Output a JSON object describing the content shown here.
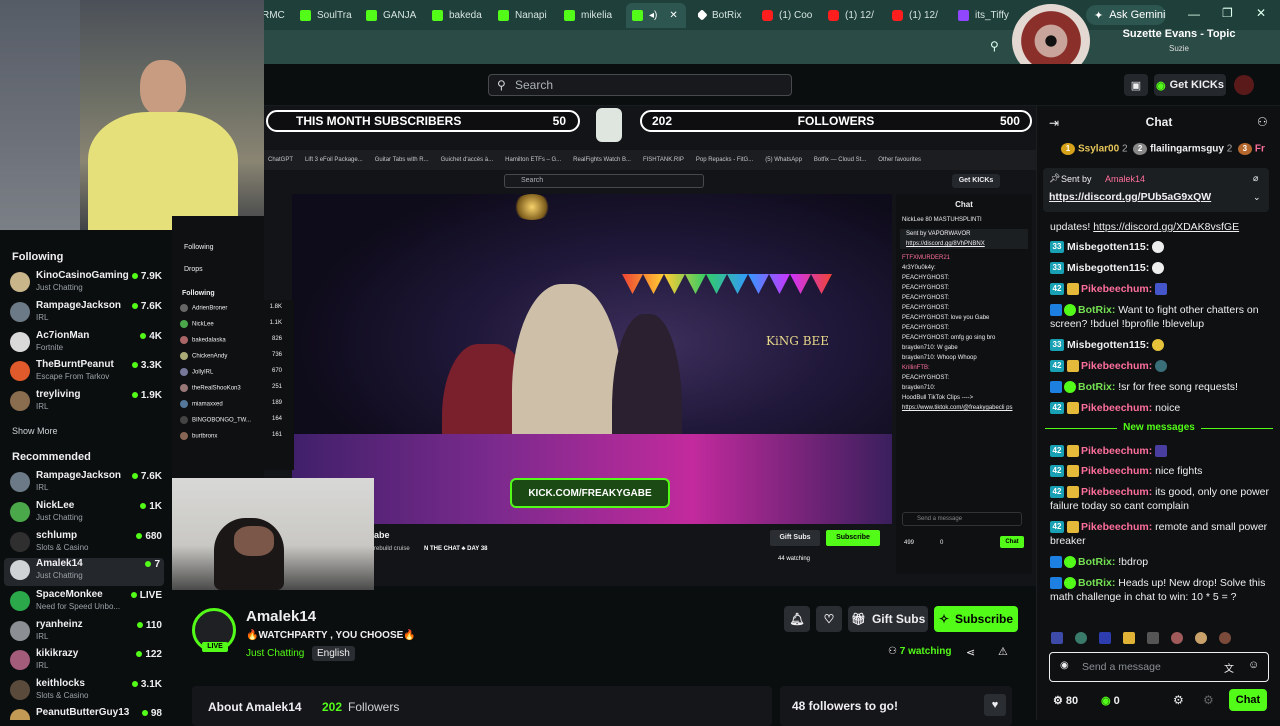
{
  "browser": {
    "tabs": [
      {
        "label": "RMC",
        "icon": "kick"
      },
      {
        "label": "SoulTra",
        "icon": "kick"
      },
      {
        "label": "GANJA",
        "icon": "kick"
      },
      {
        "label": "bakeda",
        "icon": "kick"
      },
      {
        "label": "Nanapi",
        "icon": "kick"
      },
      {
        "label": "mikelia",
        "icon": "kick"
      },
      {
        "label": "",
        "icon": "kick"
      },
      {
        "label": "BotRix",
        "icon": "botrix"
      },
      {
        "label": "(1) Coo",
        "icon": "youtube"
      },
      {
        "label": "(1) 12/",
        "icon": "youtube"
      },
      {
        "label": "(1) 12/",
        "icon": "youtube"
      },
      {
        "label": "its_Tiffy",
        "icon": "twitch"
      }
    ],
    "ask_gemini": "Ask Gemini"
  },
  "media": {
    "title": "Suzette Evans - Topic",
    "artist": "Suzie"
  },
  "header": {
    "search_placeholder": "Search",
    "get_kicks": "Get KICKs"
  },
  "overlay": {
    "subs_label": "THIS MONTH SUBSCRIBERS",
    "subs_value": "50",
    "followers_current": "202",
    "followers_label": "FOLLOWERS",
    "followers_goal": "500"
  },
  "inner": {
    "search_placeholder": "Search",
    "get_kicks": "Get KICKs",
    "bookmarks": [
      "ChatGPT",
      "Lift 3 eFoil Package...",
      "Guitar Tabs with R...",
      "Guichet d'accès à...",
      "Hamilton ETFs – G...",
      "RealFights Watch B...",
      "FISHTANK.RIP",
      "Pop Repacks - FitG...",
      "(5) WhatsApp",
      "Botfix — Cloud St...",
      "Other favourites"
    ],
    "nav": [
      "Following",
      "Drops"
    ],
    "following_header": "Following",
    "following": [
      {
        "name": "AdrienBroner",
        "cat": "",
        "viewers": "1.8K"
      },
      {
        "name": "NickLee",
        "cat": "Just Chatting",
        "viewers": "1.1K"
      },
      {
        "name": "bakedalaska",
        "cat": "The Legend of Zelda:...",
        "viewers": "826"
      },
      {
        "name": "ChickenAndy",
        "cat": "IRL",
        "viewers": "736"
      },
      {
        "name": "JollyIRL",
        "cat": "IRL",
        "viewers": "670"
      },
      {
        "name": "theRealShooKon3",
        "cat": "IRL",
        "viewers": "251"
      },
      {
        "name": "miamaxxed",
        "cat": "IRL",
        "viewers": "189"
      },
      {
        "name": "BINGOBONGO_TW...",
        "cat": "Silent Hill 2 Remake",
        "viewers": "164"
      },
      {
        "name": "burtbronx",
        "cat": "IRL",
        "viewers": "161"
      }
    ],
    "banner": "KICK.COM/FREAKYGABE",
    "stage_sign": "KiNG BEE",
    "streamer_partial": "abe",
    "stream_title_partial": "rebuild cruise",
    "ticker": "N THE CHAT ♣ DAY 38",
    "gift_subs": "Gift Subs",
    "subscribe": "Subscribe",
    "watching": "44 watching",
    "chat_title": "Chat",
    "chat_lines": [
      "NickLee 80  MASTUHSPLINTI",
      "Sent by VAPORWAVOR",
      "https://discord.gg/8VhPNBNX",
      "FTFXMURDER21",
      "4r3Y0u0k4y:",
      "PEACHYGHOST:",
      "PEACHYGHOST:",
      "PEACHYGHOST:",
      "PEACHYGHOST:",
      "PEACHYGHOST: love you Gabe",
      "PEACHYGHOST:",
      "PEACHYGHOST: omfg go sing bro",
      "brayden710: W gabe",
      "brayden710: Whoop Whoop",
      "KrillinFTB:",
      "PEACHYGHOST:",
      "brayden710:",
      "HoodBull TikTok Clips ---->",
      "https://www.tiktok.com/@freakygabecli ps"
    ],
    "send_placeholder": "Send a message",
    "points": "499",
    "kicks": "0",
    "chat_btn": "Chat"
  },
  "sidebar": {
    "following_header": "Following",
    "following": [
      {
        "name": "KinoCasinoGaming",
        "cat": "Just Chatting",
        "viewers": "7.9K",
        "color": "#c9b58a"
      },
      {
        "name": "RampageJackson",
        "cat": "IRL",
        "viewers": "7.6K",
        "color": "#6b7a86"
      },
      {
        "name": "Ac7ionMan",
        "cat": "Fortnite",
        "viewers": "4K",
        "color": "#d9d9d9"
      },
      {
        "name": "TheBurntPeanut",
        "cat": "Escape From Tarkov",
        "viewers": "3.3K",
        "color": "#e05a2b"
      },
      {
        "name": "treyliving",
        "cat": "IRL",
        "viewers": "1.9K",
        "color": "#8a6d4f"
      }
    ],
    "show_more": "Show More",
    "recommended_header": "Recommended",
    "recommended": [
      {
        "name": "RampageJackson",
        "cat": "IRL",
        "viewers": "7.6K",
        "color": "#6b7a86"
      },
      {
        "name": "NickLee",
        "cat": "Just Chatting",
        "viewers": "1K",
        "color": "#4aa84a"
      },
      {
        "name": "schlump",
        "cat": "Slots & Casino",
        "viewers": "680",
        "color": "#2f2f2f"
      },
      {
        "name": "Amalek14",
        "cat": "Just Chatting",
        "viewers": "7",
        "color": "#cfd3d6"
      },
      {
        "name": "SpaceMonkee",
        "cat": "Need for Speed Unbo...",
        "viewers": "LIVE",
        "color": "#2ba84a"
      },
      {
        "name": "ryanheinz",
        "cat": "IRL",
        "viewers": "110",
        "color": "#8b8f93"
      },
      {
        "name": "kikikrazy",
        "cat": "IRL",
        "viewers": "122",
        "color": "#a35c7a"
      },
      {
        "name": "keithlocks",
        "cat": "Slots & Casino",
        "viewers": "3.1K",
        "color": "#5a4a3c"
      },
      {
        "name": "PeanutButterGuy13",
        "cat": "",
        "viewers": "98",
        "color": "#c29a55"
      }
    ]
  },
  "stream": {
    "channel": "Amalek14",
    "title": "🔥WATCHPARTY , YOU CHOOSE🔥",
    "category": "Just Chatting",
    "tag": "English",
    "live": "LIVE",
    "gift_subs": "Gift Subs",
    "subscribe": "Subscribe",
    "watching": "7 watching",
    "about_label": "About Amalek14",
    "followers_count": "202",
    "followers_word": "Followers",
    "goal": "48 followers to go!"
  },
  "chat": {
    "title": "Chat",
    "top_gifters": [
      {
        "rank": "1",
        "name": "Ssylar00",
        "count": "2"
      },
      {
        "rank": "2",
        "name": "flailingarmsguy",
        "count": "2"
      },
      {
        "rank": "3",
        "name": "Fr",
        "count": ""
      }
    ],
    "pinned": {
      "sent_by": "Sent by",
      "user": "Amalek14",
      "link": "https://discord.gg/PUb5aG9xQW"
    },
    "messages": [
      {
        "user": "",
        "text": "updates! ",
        "link": "https://discord.gg/XDAK8vsfGE"
      },
      {
        "badge": "33",
        "user": "Misbegotten115:",
        "text": ""
      },
      {
        "badge": "33",
        "user": "Misbegotten115:",
        "text": ""
      },
      {
        "badge": "42",
        "user": "Pikebeechum:",
        "text": ""
      },
      {
        "badge": "",
        "user": "BotRix:",
        "text": "Want to fight other chatters on screen? !bduel !bprofile !blevelup"
      },
      {
        "badge": "33",
        "user": "Misbegotten115:",
        "text": ""
      },
      {
        "badge": "42",
        "user": "Pikebeechum:",
        "text": ""
      },
      {
        "badge": "",
        "user": "BotRix:",
        "text": "!sr for free song requests!"
      },
      {
        "badge": "42",
        "user": "Pikebeechum:",
        "text": "noice"
      }
    ],
    "new_messages": "New messages",
    "messages2": [
      {
        "badge": "42",
        "user": "Pikebeechum:",
        "text": ""
      },
      {
        "badge": "42",
        "user": "Pikebeechum:",
        "text": "nice fights"
      },
      {
        "badge": "42",
        "user": "Pikebeechum:",
        "text": "its good, only one power failure today so cant complain"
      },
      {
        "badge": "42",
        "user": "Pikebeechum:",
        "text": "remote and small power breaker"
      },
      {
        "badge": "",
        "user": "BotRix:",
        "text": "!bdrop"
      },
      {
        "badge": "",
        "user": "BotRix:",
        "text": "Heads up! New drop! Solve this math challenge in chat to win: 10 * 5 = ?"
      }
    ],
    "input_placeholder": "Send a message",
    "points": "80",
    "kicks": "0",
    "chat_btn": "Chat"
  }
}
